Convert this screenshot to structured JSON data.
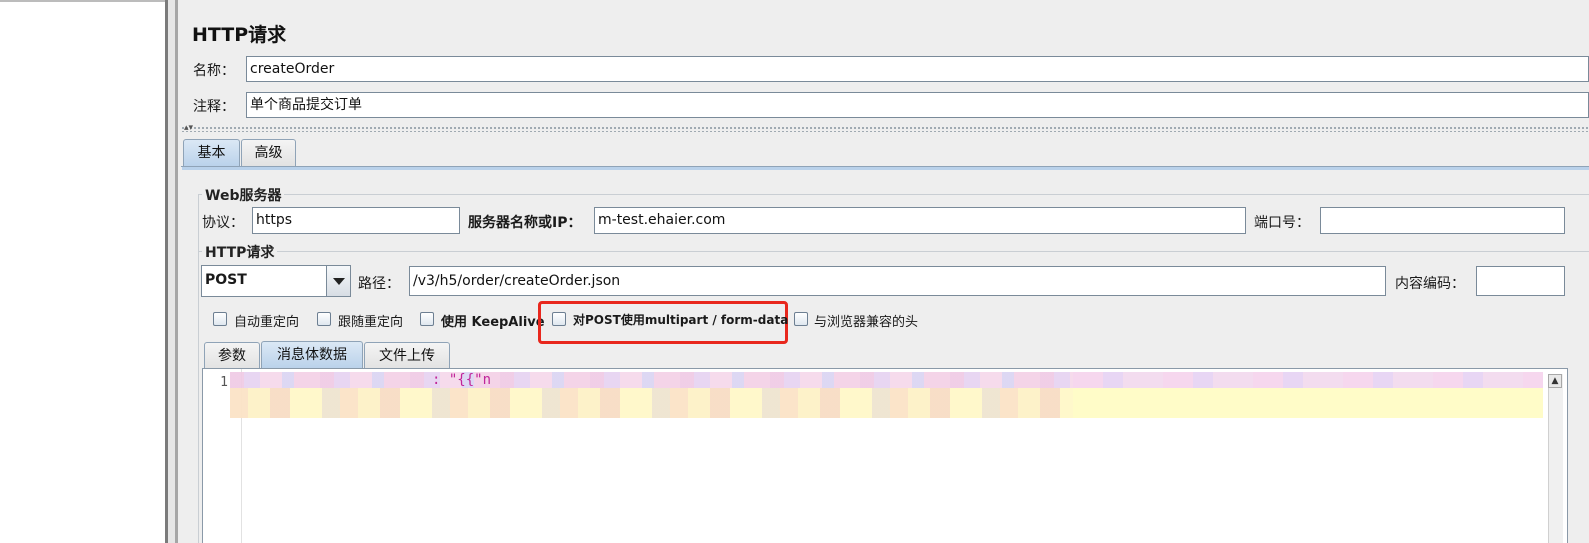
{
  "panel": {
    "title": "HTTP请求",
    "name_label": "名称：",
    "name_value": "createOrder",
    "comment_label": "注释：",
    "comment_value": "单个商品提交订单"
  },
  "tabs": [
    {
      "label": "基本",
      "active": true
    },
    {
      "label": "高级",
      "active": false
    }
  ],
  "web_server": {
    "group_title": "Web服务器",
    "protocol_label": "协议：",
    "protocol_value": "https",
    "server_label": "服务器名称或IP：",
    "server_value": "m-test.ehaier.com",
    "port_label": "端口号：",
    "port_value": ""
  },
  "http_request": {
    "group_title": "HTTP请求",
    "method": "POST",
    "path_label": "路径：",
    "path_value": "/v3/h5/order/createOrder.json",
    "encoding_label": "内容编码：",
    "encoding_value": ""
  },
  "options": [
    {
      "label": "自动重定向",
      "checked": false
    },
    {
      "label": "跟随重定向",
      "checked": false
    },
    {
      "label": "使用 KeepAlive",
      "checked": false
    },
    {
      "label": "对POST使用multipart / form-data",
      "checked": false,
      "highlighted": true
    },
    {
      "label": "与浏览器兼容的头",
      "checked": false
    }
  ],
  "body_tabs": [
    {
      "label": "参数",
      "active": false
    },
    {
      "label": "消息体数据",
      "active": true
    },
    {
      "label": "文件上传",
      "active": false
    }
  ],
  "editor": {
    "line_number": "1",
    "code_visible": ": \"{{\"n"
  },
  "colors": {
    "highlight_border": "#e8271d",
    "active_tab": "#b9d1ea",
    "background": "#eeeeee"
  }
}
